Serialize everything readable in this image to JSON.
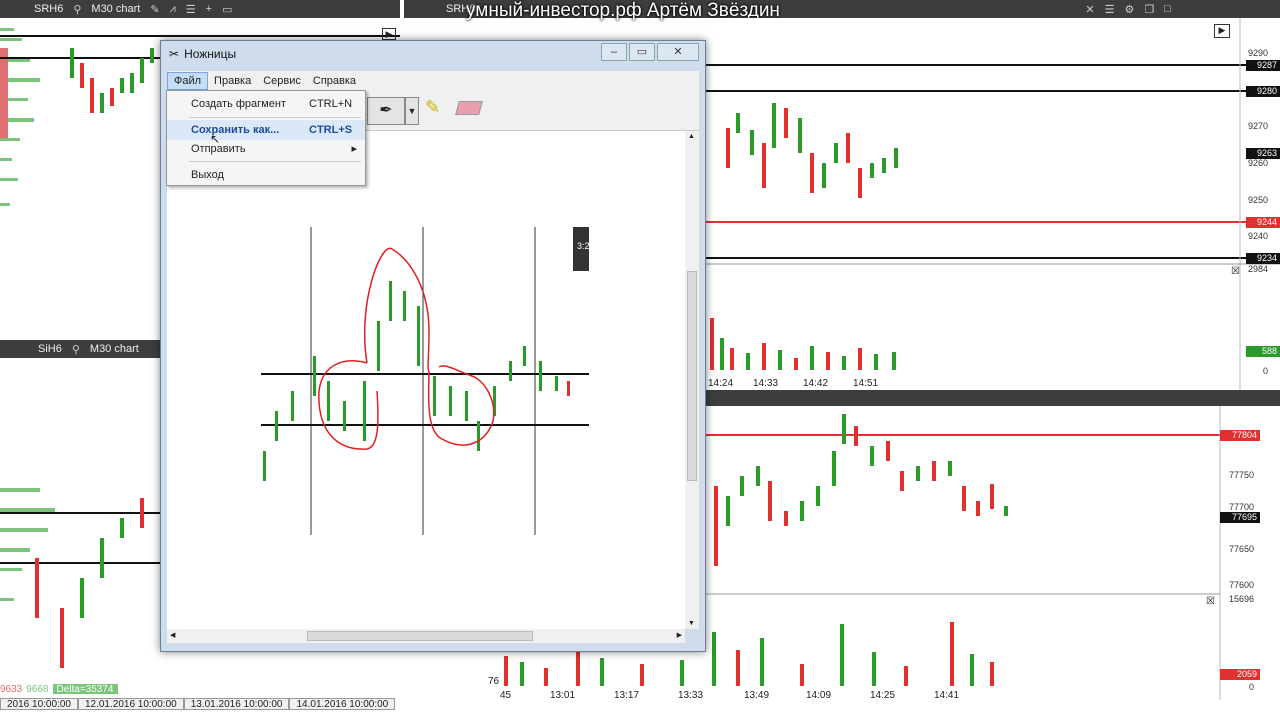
{
  "watermark": "умный-инвестор.рф Артём Звёздин",
  "top_left_toolbar": {
    "symbol": "SRH6",
    "chart_type": "M30 chart"
  },
  "top_right_toolbar": {
    "symbol": "SRH6"
  },
  "left_bottom_toolbar": {
    "symbol": "SiH6",
    "chart_type": "M30 chart"
  },
  "right_top_chart": {
    "price_labels": [
      "9290",
      "9270",
      "9260",
      "9250",
      "9240"
    ],
    "price_boxes": [
      "9287",
      "9280",
      "9263",
      "9244",
      "9234"
    ],
    "volume_labels": {
      "max": "2984",
      "last": "588",
      "zero": "0"
    },
    "time_labels": [
      "14:24",
      "14:33",
      "14:42",
      "14:51"
    ]
  },
  "right_bottom_chart": {
    "price_labels": [
      "77750",
      "77700",
      "77650",
      "77600"
    ],
    "price_boxes": [
      "77804",
      "77695"
    ],
    "volume_labels": {
      "max": "15696",
      "last": "2059",
      "zero": "0"
    },
    "time_labels": [
      "45",
      "13:01",
      "13:17",
      "13:33",
      "13:49",
      "14:09",
      "14:25",
      "14:41"
    ],
    "left_partial_label": "76"
  },
  "left_bottom_status": {
    "val1": "9633",
    "val2": "9668",
    "delta": "Delta=35374"
  },
  "bottom_dates": [
    "2016 10:00:00",
    "12.01.2016 10:00:00",
    "13.01.2016 10:00:00",
    "14.01.2016 10:00:00"
  ],
  "snipping_tool": {
    "title": "Ножницы",
    "menu": [
      "Файл",
      "Правка",
      "Сервис",
      "Справка"
    ],
    "file_menu": [
      {
        "label": "Создать фрагмент",
        "shortcut": "CTRL+N"
      },
      {
        "label": "Сохранить как...",
        "shortcut": "CTRL+S"
      },
      {
        "label": "Отправить",
        "shortcut": ""
      },
      {
        "label": "Выход",
        "shortcut": ""
      }
    ],
    "canvas_label": "3:2"
  }
}
